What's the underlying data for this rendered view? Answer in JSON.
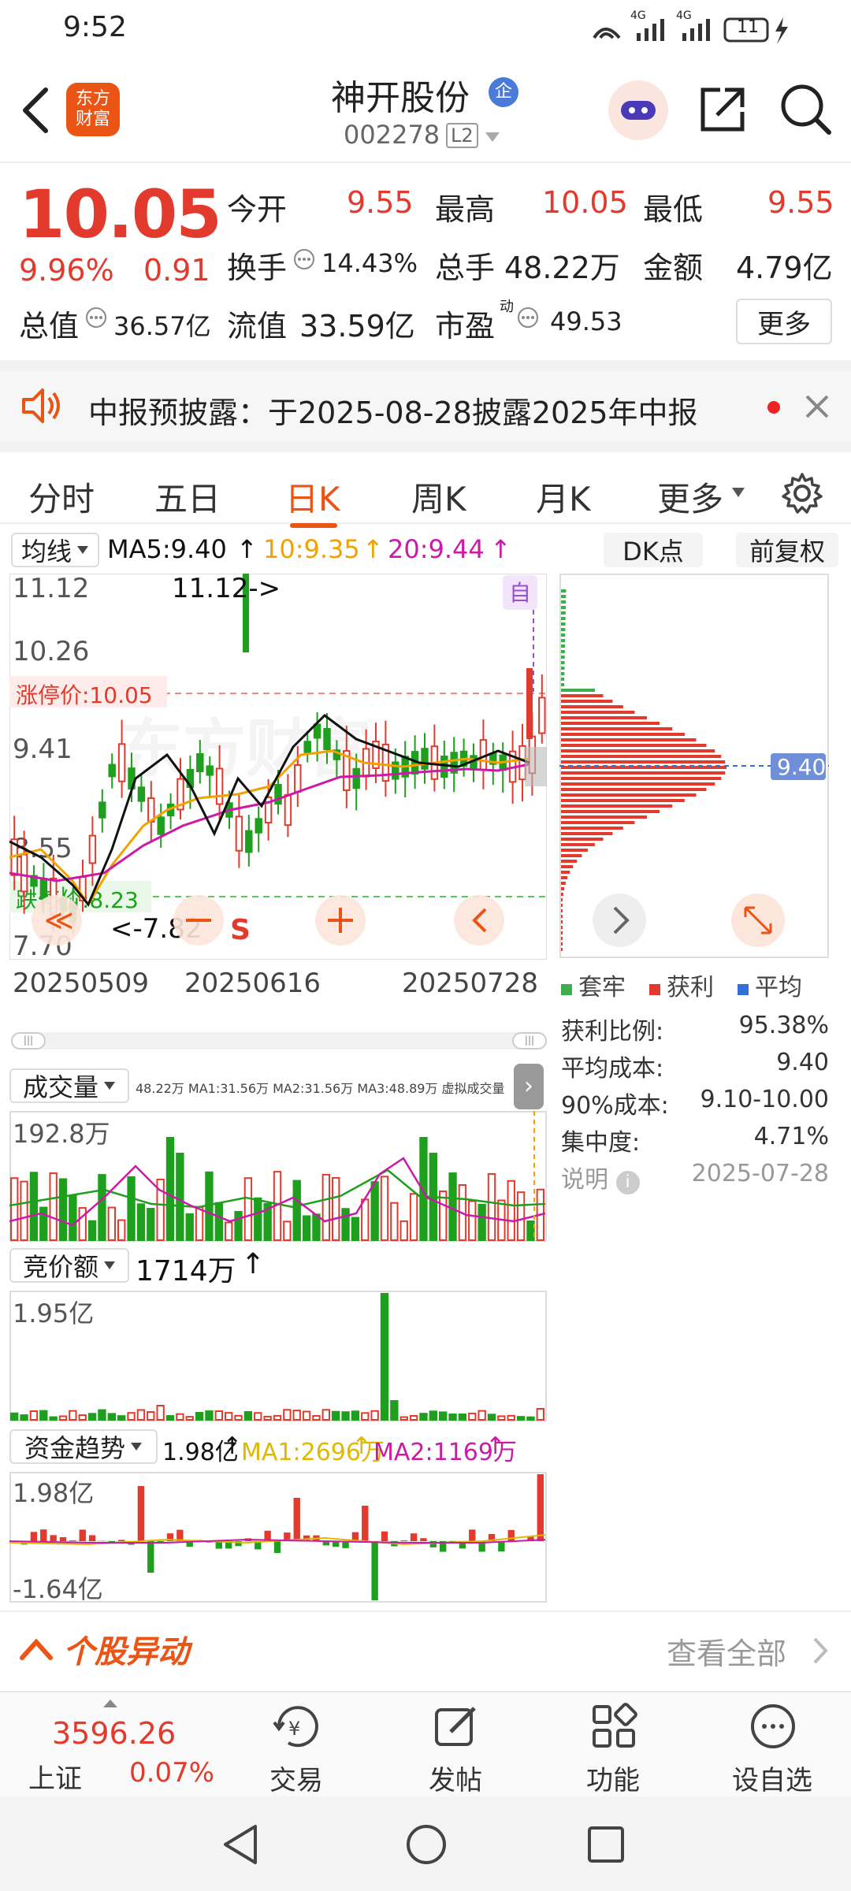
{
  "status": {
    "time": "9:52",
    "battery": "11",
    "net1": "4G",
    "net2": "4G"
  },
  "header": {
    "brand_line1": "东方",
    "brand_line2": "财富",
    "stock_name": "神开股份",
    "stock_badge": "企",
    "stock_code": "002278",
    "level": "L2"
  },
  "quote": {
    "price": "10.05",
    "change_pct": "9.96%",
    "change": "0.91",
    "open_label": "今开",
    "open": "9.55",
    "high_label": "最高",
    "high": "10.05",
    "low_label": "最低",
    "low": "9.55",
    "turnover_label": "换手",
    "turnover": "14.43%",
    "volume_label": "总手",
    "volume": "48.22万",
    "amount_label": "金额",
    "amount": "4.79亿",
    "mktcap_label": "总值",
    "mktcap": "36.57亿",
    "float_label": "流值",
    "float": "33.59亿",
    "pe_label": "市盈",
    "pe_sup": "动",
    "pe": "49.53",
    "more": "更多"
  },
  "notice": {
    "text": "中报预披露：于2025-08-28披露2025年中报"
  },
  "tabs": [
    "分时",
    "五日",
    "日K",
    "周K",
    "月K",
    "更多"
  ],
  "active_tab": "日K",
  "kline": {
    "ma_selector": "均线",
    "ma5": "MA5:9.40",
    "ma10": "10:9.35",
    "ma20": "20:9.44",
    "dk_button": "DK点",
    "adj_button": "前复权",
    "y_labels": [
      "11.12",
      "10.26",
      "9.41",
      "8.55",
      "7.70"
    ],
    "limit_up": "涨停价:10.05",
    "limit_down": "跌停价:8.23",
    "high_annot": "11.12->",
    "low_annot": "<-7.82",
    "s_mark": "S",
    "auto_tag": "自",
    "dates": [
      "20250509",
      "20250616",
      "20250728"
    ]
  },
  "chips": {
    "avg_tag": "9.40",
    "legend": [
      "套牢",
      "获利",
      "平均"
    ],
    "rows": [
      {
        "label": "获利比例:",
        "value": "95.38%"
      },
      {
        "label": "平均成本:",
        "value": "9.40"
      },
      {
        "label": "90%成本:",
        "value": "9.10-10.00"
      },
      {
        "label": "集中度:",
        "value": "4.71%"
      }
    ],
    "note_label": "说明",
    "note_date": "2025-07-28"
  },
  "volume": {
    "selector": "成交量",
    "stats": "48.22万  MA1:31.56万  MA2:31.56万  MA3:48.89万  虚拟成交量:192.8万",
    "top": "192.8万"
  },
  "auction": {
    "selector": "竞价额",
    "value": "1714万",
    "top": "1.95亿"
  },
  "fund": {
    "selector": "资金趋势",
    "value": "1.98亿",
    "ma1": "MA1:2696万",
    "ma2": "MA2:1169万",
    "top": "1.98亿",
    "bottom": "-1.64亿"
  },
  "movement": {
    "title": "个股异动",
    "view_all": "查看全部"
  },
  "bottom": {
    "index_value": "3596.26",
    "index_name": "上证",
    "index_pct": "0.07%",
    "trade": "交易",
    "post": "发帖",
    "func": "功能",
    "watch": "设自选"
  },
  "colors": {
    "up": "#e23a2c",
    "down": "#1ea01e",
    "accent": "#ea5414",
    "ma5": "#111111",
    "ma10": "#f2a200",
    "ma20": "#cc1aa8"
  },
  "chart_data": {
    "type": "candlestick",
    "y_axis_labels": [
      11.12,
      10.26,
      9.41,
      8.55,
      7.7
    ],
    "limit_up": 10.05,
    "limit_down": 8.23,
    "high": 11.12,
    "low": 7.82,
    "x_labels": [
      "20250509",
      "20250616",
      "20250728"
    ],
    "ma": {
      "MA5": 9.4,
      "MA10": 9.35,
      "MA20": 9.44
    }
  }
}
